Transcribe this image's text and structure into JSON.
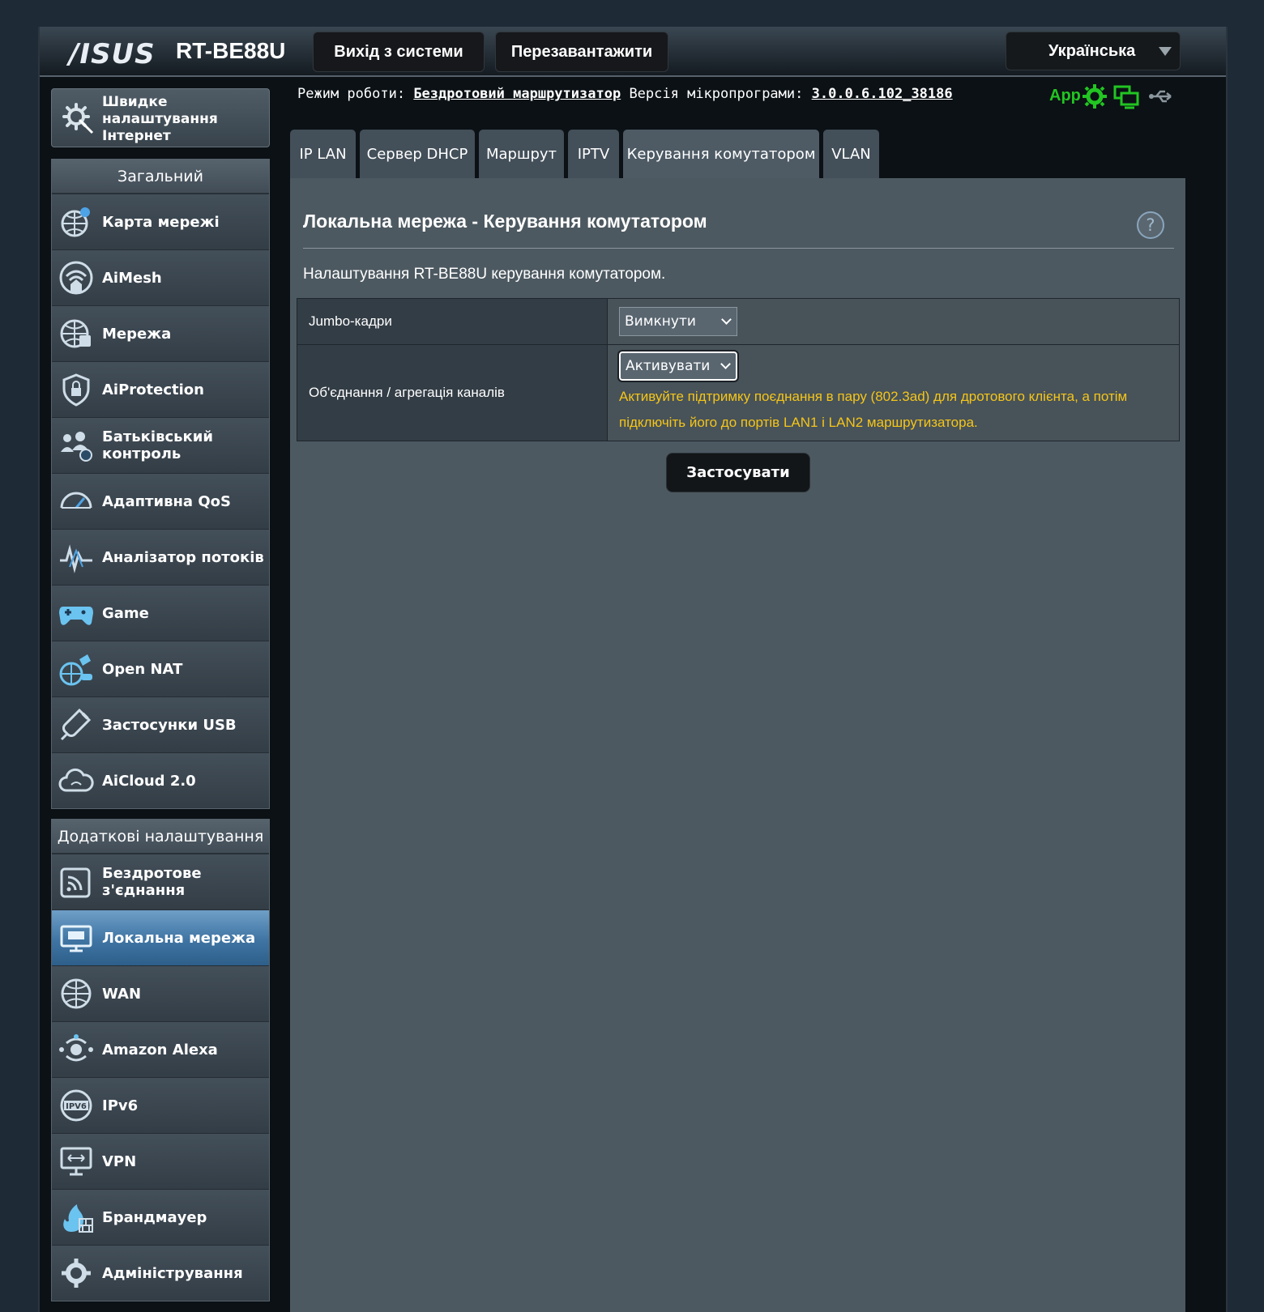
{
  "header": {
    "brand": "/ISUS",
    "model": "RT-BE88U",
    "logout_label": "Вихід з системи",
    "reboot_label": "Перезавантажити",
    "language": "Українська"
  },
  "status": {
    "mode_label": "Режим роботи:",
    "mode_value": "Бездротовий маршрутизатор",
    "firmware_label": "Версія мікропрограми:",
    "firmware_value": "3.0.0.6.102_38186",
    "app_label": "App",
    "colors": {
      "app": "#22c522",
      "warning": "#f5c518"
    }
  },
  "sidebar": {
    "quick_setup": "Швидке налаштування Інтернет",
    "general_title": "Загальний",
    "general_items": [
      {
        "label": "Карта мережі",
        "icon": "network-map-icon"
      },
      {
        "label": "AiMesh",
        "icon": "aimesh-icon"
      },
      {
        "label": "Мережа",
        "icon": "network-icon"
      },
      {
        "label": "AiProtection",
        "icon": "shield-icon"
      },
      {
        "label": "Батьківський контроль",
        "icon": "parental-control-icon"
      },
      {
        "label": "Адаптивна QoS",
        "icon": "qos-gauge-icon"
      },
      {
        "label": "Аналізатор потоків",
        "icon": "traffic-analyzer-icon"
      },
      {
        "label": "Game",
        "icon": "gamepad-icon"
      },
      {
        "label": "Open NAT",
        "icon": "open-nat-icon"
      },
      {
        "label": "Застосунки USB",
        "icon": "usb-icon"
      },
      {
        "label": "AiCloud 2.0",
        "icon": "cloud-icon"
      }
    ],
    "advanced_title": "Додаткові налаштування",
    "advanced_items": [
      {
        "label": "Бездротове з'єднання",
        "icon": "wireless-icon"
      },
      {
        "label": "Локальна мережа",
        "icon": "lan-icon"
      },
      {
        "label": "WAN",
        "icon": "globe-icon"
      },
      {
        "label": "Amazon Alexa",
        "icon": "alexa-icon"
      },
      {
        "label": "IPv6",
        "icon": "ipv6-icon"
      },
      {
        "label": "VPN",
        "icon": "vpn-icon"
      },
      {
        "label": "Брандмауер",
        "icon": "firewall-icon"
      },
      {
        "label": "Адміністрування",
        "icon": "gear-icon"
      }
    ]
  },
  "tabs": [
    "IP LAN",
    "Сервер DHCP",
    "Маршрут",
    "IPTV",
    "Керування комутатором",
    "VLAN"
  ],
  "main": {
    "title": "Локальна мережа - Керування комутатором",
    "help": "?",
    "description": "Налаштування RT-BE88U керування комутатором.",
    "jumbo_label": "Jumbo-кадри",
    "jumbo_value": "Вимкнути",
    "bonding_label": "Об'єднання / агрегація каналів",
    "bonding_value": "Активувати",
    "bonding_hint_1": "Активуйте підтримку поєднання в пару (802.3ad) для дротового клієнта, а потім",
    "bonding_hint_2": "підключіть його до портів LAN1 і LAN2 маршрутизатора.",
    "apply_label": "Застосувати"
  }
}
